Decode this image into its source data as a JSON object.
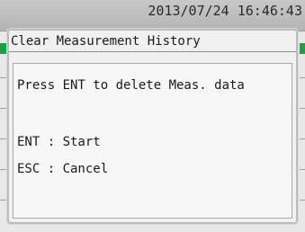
{
  "status_bar": {
    "datetime": "2013/07/24 16:46:43"
  },
  "dialog": {
    "title": "Clear Measurement History",
    "message": "Press ENT to delete Meas. data",
    "ent_instruction": "ENT : Start",
    "esc_instruction": "ESC : Cancel"
  },
  "colors": {
    "status_bar": "#b4b4b4",
    "dialog_background": "#f0f0f0",
    "underlying_accent": "#1e9e4a"
  }
}
